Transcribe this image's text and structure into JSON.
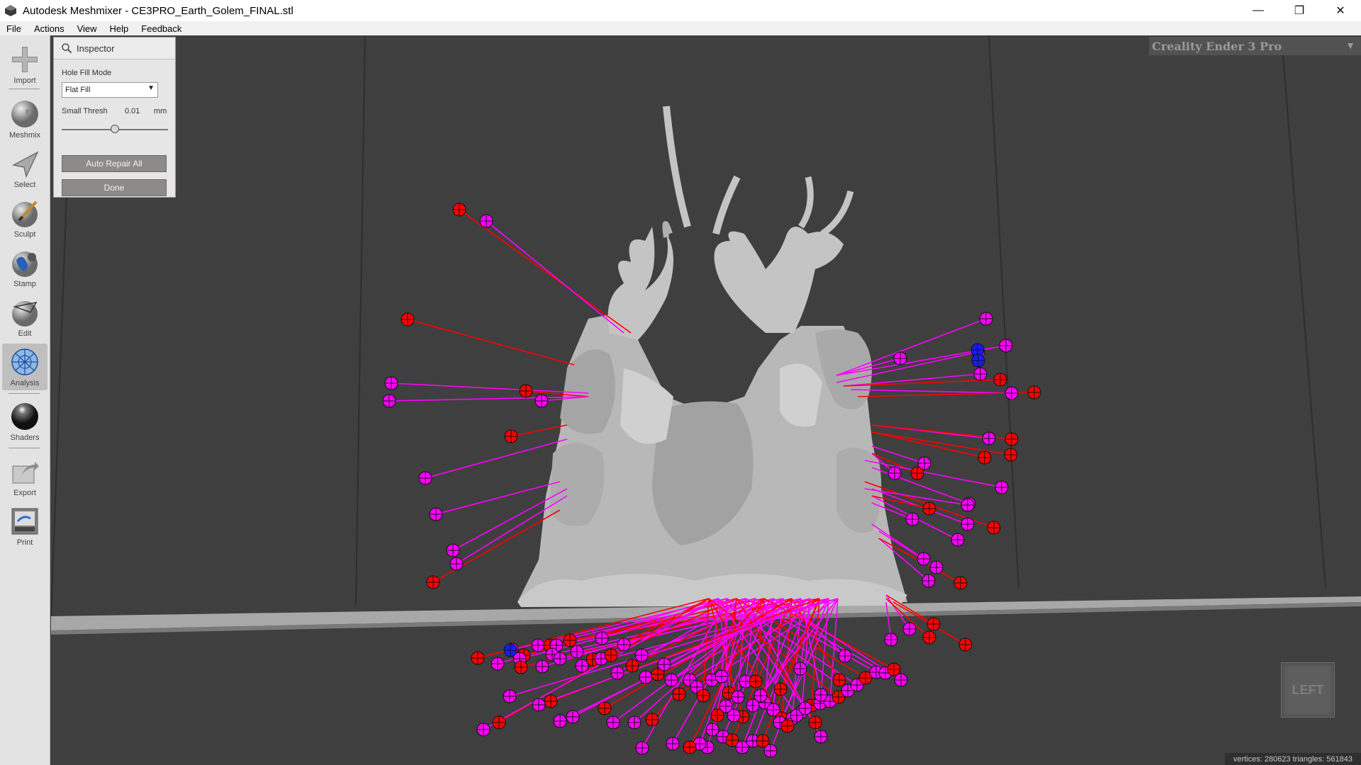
{
  "window": {
    "title": "Autodesk Meshmixer - CE3PRO_Earth_Golem_FINAL.stl",
    "minimize": "—",
    "restore": "❐",
    "close": "✕"
  },
  "menu": [
    "File",
    "Actions",
    "View",
    "Help",
    "Feedback"
  ],
  "toolbar": [
    {
      "label": "Import",
      "icon": "import-icon"
    },
    {
      "label": "Meshmix",
      "icon": "meshmix-icon"
    },
    {
      "label": "Select",
      "icon": "select-icon"
    },
    {
      "label": "Sculpt",
      "icon": "sculpt-icon"
    },
    {
      "label": "Stamp",
      "icon": "stamp-icon"
    },
    {
      "label": "Edit",
      "icon": "edit-icon"
    },
    {
      "label": "Analysis",
      "icon": "analysis-icon",
      "active": true
    },
    {
      "label": "Shaders",
      "icon": "shaders-icon"
    },
    {
      "label": "Export",
      "icon": "export-icon"
    },
    {
      "label": "Print",
      "icon": "print-icon"
    }
  ],
  "inspector": {
    "title": "Inspector",
    "hole_fill_label": "Hole Fill Mode",
    "hole_fill_value": "Flat Fill",
    "small_thresh_label": "Small Thresh",
    "small_thresh_value": "0.01",
    "small_thresh_unit": "mm",
    "small_thresh_slider": 0.5,
    "auto_repair_label": "Auto Repair All",
    "done_label": "Done"
  },
  "printer": {
    "name": "Creality Ender 3 Pro"
  },
  "viewcube": {
    "label": "LEFT"
  },
  "status": {
    "text": "vertices: 280623  triangles: 561843"
  },
  "colors": {
    "error_marker": "#ff0000",
    "warning_marker": "#ff00ff",
    "other_marker": "#1a1aff",
    "mesh": "#bdbdbd",
    "background": "#3f3f3f"
  }
}
